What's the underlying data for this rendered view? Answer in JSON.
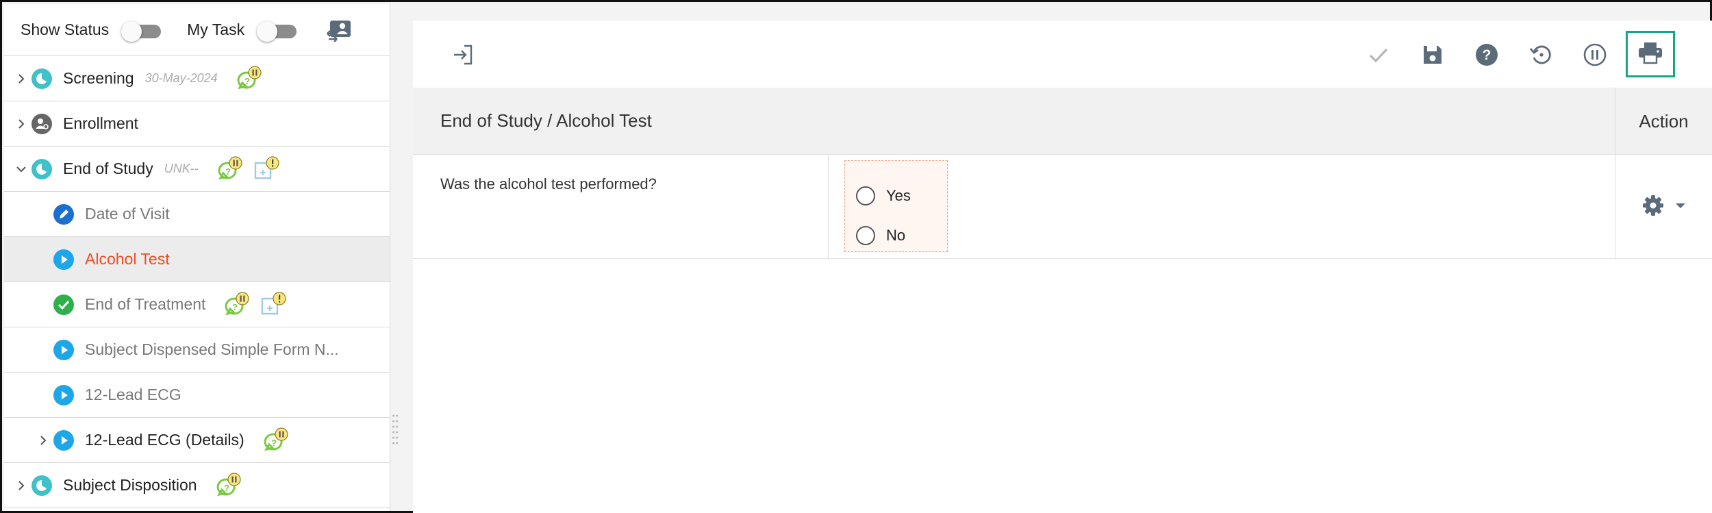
{
  "sidebar": {
    "show_status_label": "Show Status",
    "my_task_label": "My Task",
    "items": [
      {
        "label": "Screening",
        "date": "30-May-2024"
      },
      {
        "label": "Enrollment"
      },
      {
        "label": "End of Study",
        "date": "UNK--"
      },
      {
        "label": "Date of Visit"
      },
      {
        "label": "Alcohol Test"
      },
      {
        "label": "End of Treatment"
      },
      {
        "label": "Subject Dispensed Simple Form N..."
      },
      {
        "label": "12-Lead ECG"
      },
      {
        "label": "12-Lead ECG (Details)"
      },
      {
        "label": "Subject Disposition"
      }
    ]
  },
  "toolbar": {
    "icons": [
      "exit-to-form-icon",
      "check-icon",
      "save-icon",
      "help-icon",
      "history-icon",
      "pause-icon",
      "print-icon"
    ]
  },
  "main": {
    "breadcrumb": "End of Study / Alcohol Test",
    "action_header": "Action",
    "question": "Was the alcohol test performed?",
    "options": [
      "Yes",
      "No"
    ]
  },
  "colors": {
    "active_item": "#f04e23",
    "print_highlight": "#17a589",
    "teal_status": "#3fc1c9",
    "blue_status": "#1ea7e8",
    "green_status": "#2eb04a",
    "badge_green": "#7ac943",
    "badge_yellow": "#fbe67e"
  }
}
